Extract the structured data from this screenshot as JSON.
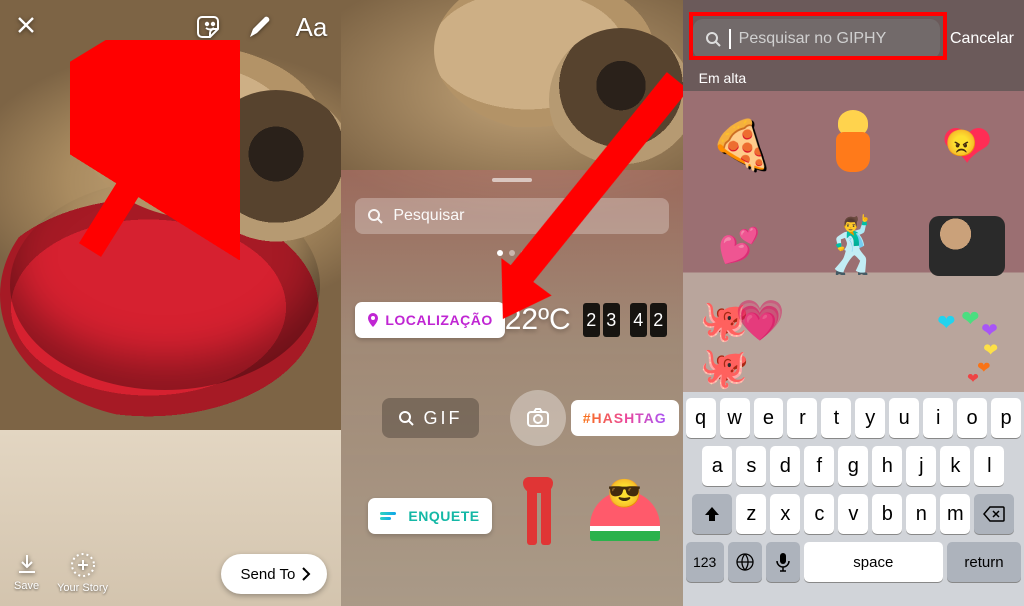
{
  "panel1": {
    "text_tool": "Aa",
    "save_label": "Save",
    "your_story_label": "Your Story",
    "send_to_label": "Send To"
  },
  "panel2": {
    "search_placeholder": "Pesquisar",
    "location_label": "LOCALIZAÇÃO",
    "temperature": "22ºC",
    "clock_digits": [
      "2",
      "3",
      "4",
      "2"
    ],
    "gif_label": "GIF",
    "hashtag_label": "#HASHTAG",
    "enquete_label": "ENQUETE"
  },
  "panel3": {
    "search_placeholder": "Pesquisar no GIPHY",
    "cancel_label": "Cancelar",
    "trending_label": "Em alta"
  },
  "keyboard": {
    "row1": [
      "q",
      "w",
      "e",
      "r",
      "t",
      "y",
      "u",
      "i",
      "o",
      "p"
    ],
    "row2": [
      "a",
      "s",
      "d",
      "f",
      "g",
      "h",
      "j",
      "k",
      "l"
    ],
    "row3": [
      "z",
      "x",
      "c",
      "v",
      "b",
      "n",
      "m"
    ],
    "num_label": "123",
    "space_label": "space",
    "return_label": "return"
  }
}
